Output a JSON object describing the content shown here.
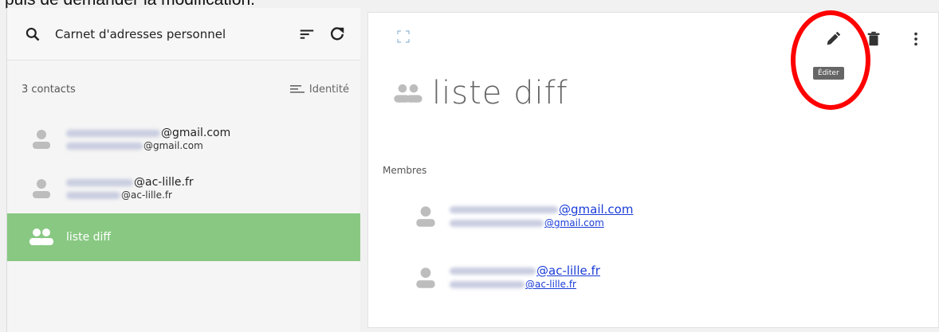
{
  "caption": "puis de demander la modification.",
  "toolbar": {
    "search_icon": "search-icon",
    "addressbook": "Carnet d'adresses personnel",
    "sort_icon": "sort-icon",
    "refresh_icon": "refresh-icon"
  },
  "list": {
    "count": "3 contacts",
    "sort_label": "Identité",
    "contacts": [
      {
        "main_suffix": "@gmail.com",
        "sub_suffix": "@gmail.com"
      },
      {
        "main_suffix": "@ac-lille.fr",
        "sub_suffix": "@ac-lille.fr"
      },
      {
        "main": "liste diff"
      }
    ]
  },
  "detail": {
    "tooltip": "Éditer",
    "title": "liste diff",
    "members_label": "Membres",
    "members": [
      {
        "main_suffix": "@gmail.com",
        "sub_suffix": "@gmail.com"
      },
      {
        "main_suffix": "@ac-lille.fr",
        "sub_suffix": "@ac-lille.fr"
      }
    ]
  },
  "colors": {
    "selected_bg": "#88c882",
    "highlight_ring": "#ff0000",
    "link": "#1a3cd6"
  }
}
